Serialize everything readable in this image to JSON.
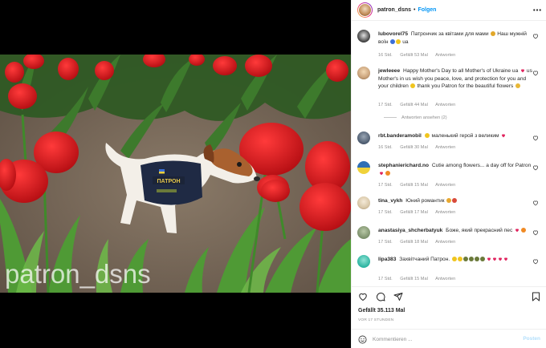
{
  "post": {
    "username": "patron_dsns",
    "follow_label": "Folgen",
    "dot": "•",
    "watermark": "patron_dsns",
    "vest_text": "ПАТРОН"
  },
  "comments": [
    {
      "user": "lubovorel75",
      "text": "Патрончик за квітами для мами",
      "text2": "Наш мужній воїн",
      "text3": "ua",
      "time": "16 Std.",
      "likes": "Gefällt 53 Mal",
      "reply": "Antworten",
      "avatar_color": "#3a3a3a"
    },
    {
      "user": "jewleeee",
      "text": "Happy Mother's Day to all Mother's of Ukraine ua",
      "text2": "us Mother's in us wish you peace, love, and protection for you and your children",
      "text3": "thank you Patron for the beautiful flowers",
      "time": "17 Std.",
      "likes": "Gefällt 44 Mal",
      "reply": "Antworten",
      "avatar_color": "#c9a27a",
      "view_replies": "Antworten ansehen (2)"
    },
    {
      "user": "rbt.banderamobil",
      "text": "маленький герой з великим",
      "time": "16 Std.",
      "likes": "Gefällt 30 Mal",
      "reply": "Antworten",
      "avatar_color": "#4b5a6e"
    },
    {
      "user": "stephanierichard.no",
      "text": "Cutie among flowers... a day off for Patron",
      "time": "17 Std.",
      "likes": "Gefällt 15 Mal",
      "reply": "Antworten",
      "avatar_color": "#2f6fb5"
    },
    {
      "user": "tina_vykh",
      "text": "Юний романтик",
      "time": "17 Std.",
      "likes": "Gefällt 17 Mal",
      "reply": "Antworten",
      "avatar_color": "#d8c7a8"
    },
    {
      "user": "anastasiya_shcherbatyuk",
      "text": "Боже, який прекрасний пес",
      "time": "17 Std.",
      "likes": "Gefällt 18 Mal",
      "reply": "Antworten",
      "avatar_color": "#7b8f6a"
    },
    {
      "user": "lipa383",
      "text": "Захвітчаний Патрон.",
      "time": "17 Std.",
      "likes": "Gefällt 15 Mal",
      "reply": "Antworten",
      "avatar_color": "#2bb3a0"
    }
  ],
  "footer": {
    "likes": "Gefällt 35.113 Mal",
    "time": "VOR 17 STUNDEN",
    "comment_placeholder": "Kommentieren ...",
    "post_label": "Posten"
  },
  "icons": {
    "more": "more-horizontal-icon",
    "like": "heart-outline-icon",
    "comment": "comment-bubble-icon",
    "share": "paper-plane-icon",
    "save": "bookmark-icon",
    "emoji": "smiley-icon"
  },
  "colors": {
    "accent": "#0095f6",
    "text": "#262626",
    "muted": "#8e8e8e",
    "heart_red": "#ed4956"
  }
}
